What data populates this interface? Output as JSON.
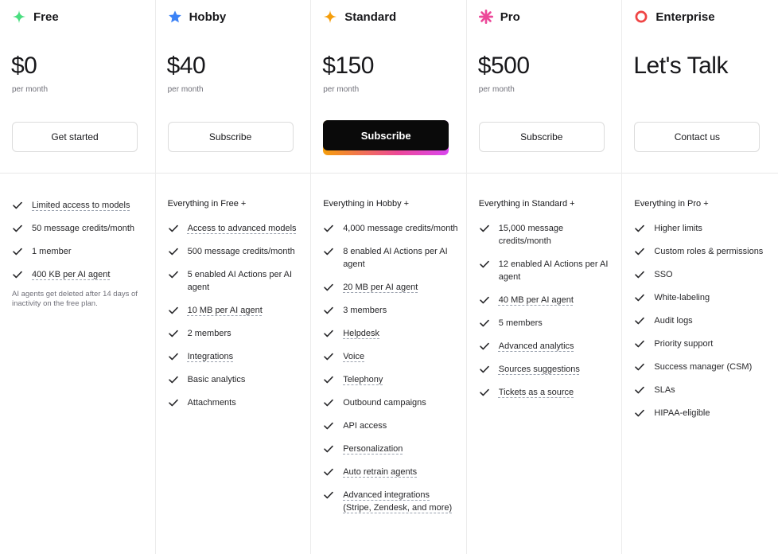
{
  "plans": [
    {
      "name": "Free",
      "icon": "green-sparkle-icon",
      "icon_color": "#4ade80",
      "price": "$0",
      "period": "per month",
      "cta": "Get started",
      "primary": false,
      "everything": "",
      "features": [
        {
          "text": "Limited access to models",
          "underline": true
        },
        {
          "text": "50 message credits/month",
          "underline": false
        },
        {
          "text": "1 member",
          "underline": false
        },
        {
          "text": "400 KB per AI agent",
          "underline": true
        }
      ],
      "note": "AI agents get deleted after 14 days of inactivity on the free plan."
    },
    {
      "name": "Hobby",
      "icon": "blue-star-icon",
      "icon_color": "#3b82f6",
      "price": "$40",
      "period": "per month",
      "cta": "Subscribe",
      "primary": false,
      "everything": "Everything in Free +",
      "features": [
        {
          "text": "Access to advanced models",
          "underline": true
        },
        {
          "text": "500 message credits/month",
          "underline": false
        },
        {
          "text": "5 enabled AI Actions per AI agent",
          "underline": false
        },
        {
          "text": "10 MB per AI agent",
          "underline": true
        },
        {
          "text": "2 members",
          "underline": false
        },
        {
          "text": "Integrations",
          "underline": true
        },
        {
          "text": "Basic analytics",
          "underline": false
        },
        {
          "text": "Attachments",
          "underline": false
        }
      ],
      "note": ""
    },
    {
      "name": "Standard",
      "icon": "orange-sparkle-icon",
      "icon_color": "#f59e0b",
      "price": "$150",
      "period": "per month",
      "cta": "Subscribe",
      "primary": true,
      "everything": "Everything in Hobby +",
      "features": [
        {
          "text": "4,000 message credits/month",
          "underline": false
        },
        {
          "text": "8 enabled AI Actions per AI agent",
          "underline": false
        },
        {
          "text": "20 MB per AI agent",
          "underline": true
        },
        {
          "text": "3 members",
          "underline": false
        },
        {
          "text": "Helpdesk",
          "underline": true
        },
        {
          "text": "Voice",
          "underline": true
        },
        {
          "text": "Telephony",
          "underline": true
        },
        {
          "text": "Outbound campaigns",
          "underline": false
        },
        {
          "text": "API access",
          "underline": false
        },
        {
          "text": "Personalization",
          "underline": true
        },
        {
          "text": "Auto retrain agents",
          "underline": true
        },
        {
          "text": "Advanced integrations (Stripe, Zendesk, and more)",
          "underline": true
        }
      ],
      "note": ""
    },
    {
      "name": "Pro",
      "icon": "pink-burst-icon",
      "icon_color": "#ec4899",
      "price": "$500",
      "period": "per month",
      "cta": "Subscribe",
      "primary": false,
      "everything": "Everything in Standard +",
      "features": [
        {
          "text": "15,000 message credits/month",
          "underline": false
        },
        {
          "text": "12 enabled AI Actions per AI agent",
          "underline": false
        },
        {
          "text": "40 MB per AI agent",
          "underline": true
        },
        {
          "text": "5 members",
          "underline": false
        },
        {
          "text": "Advanced analytics",
          "underline": true
        },
        {
          "text": "Sources suggestions",
          "underline": true
        },
        {
          "text": "Tickets as a source",
          "underline": true
        }
      ],
      "note": ""
    },
    {
      "name": "Enterprise",
      "icon": "red-ring-icon",
      "icon_color": "#ef4444",
      "price": "Let's Talk",
      "period": "",
      "cta": "Contact us",
      "primary": false,
      "everything": "Everything in Pro +",
      "features": [
        {
          "text": "Higher limits",
          "underline": false
        },
        {
          "text": "Custom roles & permissions",
          "underline": false
        },
        {
          "text": "SSO",
          "underline": false
        },
        {
          "text": "White-labeling",
          "underline": false
        },
        {
          "text": "Audit logs",
          "underline": false
        },
        {
          "text": "Priority support",
          "underline": false
        },
        {
          "text": "Success manager (CSM)",
          "underline": false
        },
        {
          "text": "SLAs",
          "underline": false
        },
        {
          "text": "HIPAA-eligible",
          "underline": false
        }
      ],
      "note": ""
    }
  ]
}
